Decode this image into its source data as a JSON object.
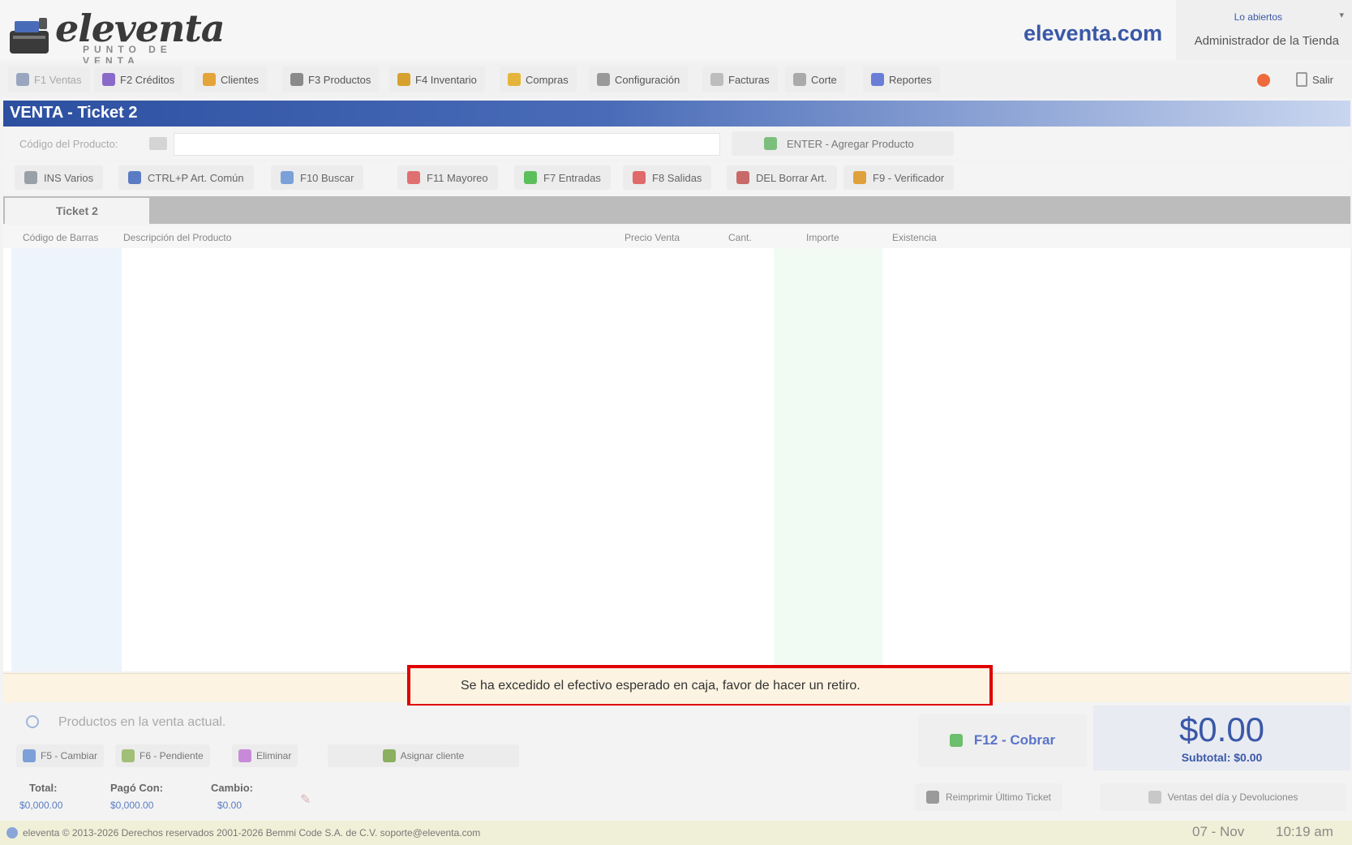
{
  "header": {
    "logo_text": "eleventa",
    "logo_sub": "PUNTO DE VENTA",
    "site": "eleventa.com",
    "user_name": "Lo abiertos",
    "user_role": "Administrador de la Tienda"
  },
  "menu": [
    {
      "label": "F1 Ventas",
      "icon": "cart-icon",
      "color": "#9aa6c0"
    },
    {
      "label": "F2 Créditos",
      "icon": "credit-icon",
      "color": "#8a6ac8"
    },
    {
      "label": "Clientes",
      "icon": "clients-icon",
      "color": "#e5a43a"
    },
    {
      "label": "F3 Productos",
      "icon": "products-icon",
      "color": "#8a8a8a"
    },
    {
      "label": "F4 Inventario",
      "icon": "inventory-icon",
      "color": "#d6a12c"
    },
    {
      "label": "Compras",
      "icon": "purchases-icon",
      "color": "#e5b43a"
    },
    {
      "label": "Configuración",
      "icon": "settings-icon",
      "color": "#9a9a9a"
    },
    {
      "label": "Facturas",
      "icon": "invoice-icon",
      "color": "#bdbdbd"
    },
    {
      "label": "Corte",
      "icon": "cut-icon",
      "color": "#aaaaaa"
    },
    {
      "label": "Reportes",
      "icon": "reports-icon",
      "color": "#6a7ed8"
    }
  ],
  "exit_label": "Salir",
  "title": "VENTA - Ticket 2",
  "entry": {
    "label": "Código del Producto:",
    "value": "",
    "add_label": "ENTER - Agregar Producto"
  },
  "functions": [
    {
      "label": "INS Varios",
      "icon": "misc-icon",
      "color": "#9aa0a8"
    },
    {
      "label": "CTRL+P Art. Común",
      "icon": "common-item-icon",
      "color": "#5b7cc4"
    },
    {
      "label": "F10 Buscar",
      "icon": "search-icon",
      "color": "#7ca0d8"
    },
    {
      "label": "F11 Mayoreo",
      "icon": "wholesale-icon",
      "color": "#e07070"
    },
    {
      "label": "F7 Entradas",
      "icon": "cash-in-icon",
      "color": "#5cbf5c"
    },
    {
      "label": "F8 Salidas",
      "icon": "cash-out-icon",
      "color": "#e06a6a"
    },
    {
      "label": "DEL Borrar Art.",
      "icon": "delete-item-icon",
      "color": "#c86a6a"
    },
    {
      "label": "F9 - Verificador",
      "icon": "verifier-icon",
      "color": "#e0a03c"
    }
  ],
  "tab_label": "Ticket 2",
  "columns": [
    "Código de Barras",
    "Descripción del Producto",
    "Precio Venta",
    "Cant.",
    "Importe",
    "Existencia"
  ],
  "warning": "Se ha excedido el efectivo esperado en caja, favor de hacer un retiro.",
  "bottom": {
    "info_text": "Productos en la venta actual.",
    "buttons": [
      {
        "label": "F5 - Cambiar",
        "icon": "change-icon",
        "color": "#7ca0d8"
      },
      {
        "label": "F6 - Pendiente",
        "icon": "pending-icon",
        "color": "#a0c078"
      },
      {
        "label": "Eliminar",
        "icon": "remove-icon",
        "color": "#c88ad8"
      }
    ],
    "assign_label": "Asignar cliente",
    "total_label": "Total:",
    "total_value": "$0,000.00",
    "paid_label": "Pagó Con:",
    "paid_value": "$0,000.00",
    "change_label": "Cambio:",
    "change_value": "$0.00",
    "cobrar_label": "F12 - Cobrar",
    "total_big": "$0.00",
    "subtotal": "Subtotal: $0.00",
    "reprint_label": "Reimprimir Último Ticket",
    "sales_label": "Ventas del día y Devoluciones"
  },
  "status": {
    "text": "eleventa © 2013-2026 Derechos reservados 2001-2026 Bemmi Code S.A. de C.V. soporte@eleventa.com",
    "date": "07 - Nov",
    "time": "10:19 am"
  }
}
